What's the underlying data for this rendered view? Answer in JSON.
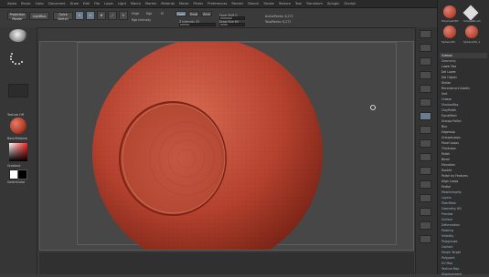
{
  "menu": [
    "Alpha",
    "Brush",
    "Color",
    "Document",
    "Draw",
    "Edit",
    "File",
    "Layer",
    "Light",
    "Macro",
    "Marker",
    "Material",
    "Movie",
    "Picker",
    "Preferences",
    "Render",
    "Stencil",
    "Stroke",
    "Texture",
    "Tool",
    "Transform",
    "Zplugin",
    "Zscript"
  ],
  "toolbar": {
    "projection_label": "Projection Master",
    "lightbox_label": "LightBox",
    "quicksketch_label": "Quick Sketch",
    "edit_label": "Edit",
    "draw_label": "Draw",
    "move_label": "Move",
    "scale_label": "Scale",
    "rotate_label": "Rotate",
    "mrgb_label": "Mrgb",
    "rgb_label": "Rgb",
    "m_label": "M",
    "zadd_label": "Zadd",
    "zsub_label": "Zsub",
    "zcut_label": "Zcut",
    "rgb_intensity_label": "Rgb Intensity",
    "z_intensity_label": "Z Intensity 25",
    "focal_shift_label": "Focal Shift 0",
    "draw_size_label": "Draw Size 64",
    "active_points_label": "ActivePoints: 6,272",
    "total_points_label": "TotalPoints: 6,272"
  },
  "left_shelf": {
    "texture_label": "Texture Off",
    "material_label": "BasicMaterial",
    "gradient_label": "Gradient",
    "switch_label": "SwitchColor",
    "alternate_label": "Alternate"
  },
  "tray": {
    "top_labels": [
      "Polymesh3D",
      "SimpleBrush",
      "Sphere3D",
      "Sphere3D_1"
    ],
    "rows": [
      {
        "text": "Subtool",
        "type": "hdr"
      },
      {
        "text": "Geometry",
        "type": "sub"
      },
      {
        "text": "Lower Res",
        "type": "row"
      },
      {
        "text": "Del Lower",
        "type": "row"
      },
      {
        "text": "Del Higher",
        "type": "row"
      },
      {
        "text": "Divide",
        "type": "row"
      },
      {
        "text": "Reconstruct Subdiv",
        "type": "row"
      },
      {
        "text": "Smt",
        "type": "row"
      },
      {
        "text": "Crease",
        "type": "row"
      },
      {
        "text": "ShadowBox",
        "type": "sub"
      },
      {
        "text": "ClayPolish",
        "type": "row"
      },
      {
        "text": "DynaMesh",
        "type": "row"
      },
      {
        "text": "Groups Polish",
        "type": "row"
      },
      {
        "text": "Blur",
        "type": "row"
      },
      {
        "text": "Edgeloop",
        "type": "row"
      },
      {
        "text": "GroupsLoops",
        "type": "row"
      },
      {
        "text": "Panel Loops",
        "type": "row"
      },
      {
        "text": "Thickness",
        "type": "row"
      },
      {
        "text": "Polish",
        "type": "row"
      },
      {
        "text": "Bevel",
        "type": "row"
      },
      {
        "text": "Elevation",
        "type": "row"
      },
      {
        "text": "Double",
        "type": "row"
      },
      {
        "text": "Polish by Features",
        "type": "row"
      },
      {
        "text": "Align Loops",
        "type": "row"
      },
      {
        "text": "Partial",
        "type": "row"
      },
      {
        "text": "MeshIntegrity",
        "type": "sub"
      },
      {
        "text": "Layers",
        "type": "sub"
      },
      {
        "text": "FiberMesh",
        "type": "sub"
      },
      {
        "text": "Geometry HD",
        "type": "sub"
      },
      {
        "text": "Preview",
        "type": "sub"
      },
      {
        "text": "Surface",
        "type": "sub"
      },
      {
        "text": "Deformation",
        "type": "sub"
      },
      {
        "text": "Masking",
        "type": "sub"
      },
      {
        "text": "Visibility",
        "type": "sub"
      },
      {
        "text": "Polygroups",
        "type": "sub"
      },
      {
        "text": "Contact",
        "type": "sub"
      },
      {
        "text": "Morph Target",
        "type": "sub"
      },
      {
        "text": "Polypaint",
        "type": "sub"
      },
      {
        "text": "UV Map",
        "type": "sub"
      },
      {
        "text": "Texture Map",
        "type": "sub"
      },
      {
        "text": "Displacement",
        "type": "sub"
      }
    ]
  },
  "colors": {
    "sphere": "#b5412e",
    "accent": "#6a7d8e"
  }
}
